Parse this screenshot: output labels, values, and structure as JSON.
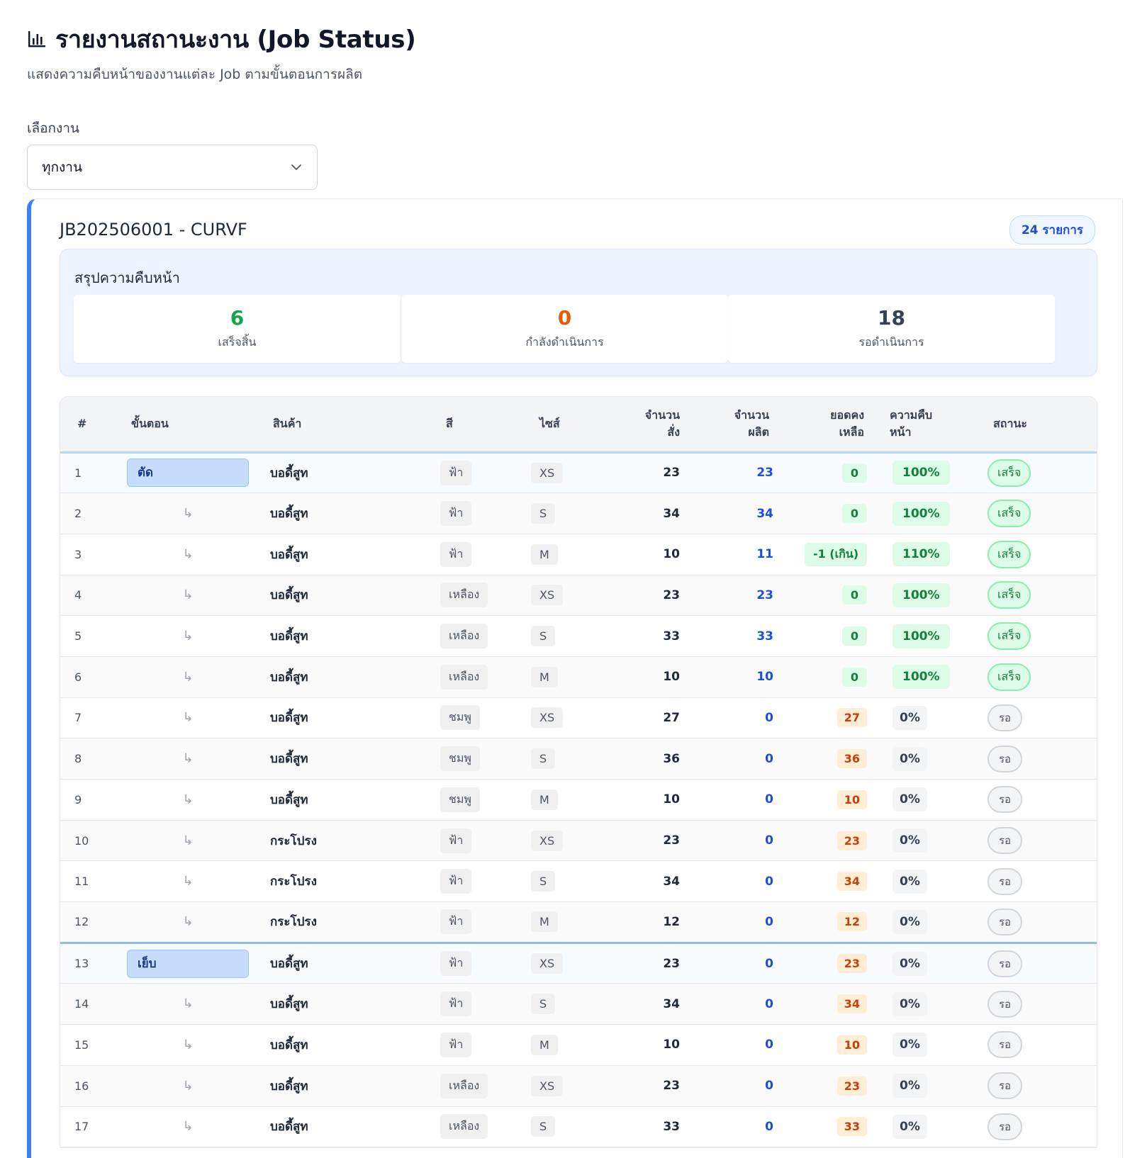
{
  "header": {
    "title": "รายงานสถานะงาน (Job Status)",
    "subtitle": "แสดงความคืบหน้าของงานแต่ละ Job ตามขั้นตอนการผลิต",
    "icon": "bar-chart-icon"
  },
  "filter": {
    "label": "เลือกงาน",
    "selected": "ทุกงาน"
  },
  "job": {
    "title": "JB202506001 - CURVF",
    "count_badge": "24 รายการ",
    "summary": {
      "title": "สรุปความคืบหน้า",
      "done": {
        "value": "6",
        "label": "เสร็จสิ้น",
        "color": "#16a34a"
      },
      "in_progress": {
        "value": "0",
        "label": "กำลังดำเนินการ",
        "color": "#ea580c"
      },
      "waiting": {
        "value": "18",
        "label": "รอดำเนินการ",
        "color": "#374151"
      }
    }
  },
  "table": {
    "headers": {
      "num": "#",
      "step": "ขั้นตอน",
      "product": "สินค้า",
      "color": "สี",
      "size": "ไซส์",
      "order_qty_1": "จำนวน",
      "order_qty_2": "สั่ง",
      "produced_1": "จำนวน",
      "produced_2": "ผลิต",
      "remain_1": "ยอดคง",
      "remain_2": "เหลือ",
      "progress_1": "ความคืบ",
      "progress_2": "หน้า",
      "status": "สถานะ"
    },
    "continuation_mark": "↳",
    "rows": [
      {
        "num": "1",
        "step": "ตัด",
        "product": "บอดี้สูท",
        "color": "ฟ้า",
        "size": "XS",
        "order": "23",
        "produced": "23",
        "remain": "0",
        "remain_kind": "ok",
        "pct": "100%",
        "status": "เสร็จ"
      },
      {
        "num": "2",
        "step": "",
        "product": "บอดี้สูท",
        "color": "ฟ้า",
        "size": "S",
        "order": "34",
        "produced": "34",
        "remain": "0",
        "remain_kind": "ok",
        "pct": "100%",
        "status": "เสร็จ"
      },
      {
        "num": "3",
        "step": "",
        "product": "บอดี้สูท",
        "color": "ฟ้า",
        "size": "M",
        "order": "10",
        "produced": "11",
        "remain": "-1 (เกิน)",
        "remain_kind": "over",
        "pct": "110%",
        "status": "เสร็จ"
      },
      {
        "num": "4",
        "step": "",
        "product": "บอดี้สูท",
        "color": "เหลือง",
        "size": "XS",
        "order": "23",
        "produced": "23",
        "remain": "0",
        "remain_kind": "ok",
        "pct": "100%",
        "status": "เสร็จ"
      },
      {
        "num": "5",
        "step": "",
        "product": "บอดี้สูท",
        "color": "เหลือง",
        "size": "S",
        "order": "33",
        "produced": "33",
        "remain": "0",
        "remain_kind": "ok",
        "pct": "100%",
        "status": "เสร็จ"
      },
      {
        "num": "6",
        "step": "",
        "product": "บอดี้สูท",
        "color": "เหลือง",
        "size": "M",
        "order": "10",
        "produced": "10",
        "remain": "0",
        "remain_kind": "ok",
        "pct": "100%",
        "status": "เสร็จ"
      },
      {
        "num": "7",
        "step": "",
        "product": "บอดี้สูท",
        "color": "ชมพู",
        "size": "XS",
        "order": "27",
        "produced": "0",
        "remain": "27",
        "remain_kind": "left",
        "pct": "0%",
        "status": "รอ"
      },
      {
        "num": "8",
        "step": "",
        "product": "บอดี้สูท",
        "color": "ชมพู",
        "size": "S",
        "order": "36",
        "produced": "0",
        "remain": "36",
        "remain_kind": "left",
        "pct": "0%",
        "status": "รอ"
      },
      {
        "num": "9",
        "step": "",
        "product": "บอดี้สูท",
        "color": "ชมพู",
        "size": "M",
        "order": "10",
        "produced": "0",
        "remain": "10",
        "remain_kind": "left",
        "pct": "0%",
        "status": "รอ"
      },
      {
        "num": "10",
        "step": "",
        "product": "กระโปรง",
        "color": "ฟ้า",
        "size": "XS",
        "order": "23",
        "produced": "0",
        "remain": "23",
        "remain_kind": "left",
        "pct": "0%",
        "status": "รอ"
      },
      {
        "num": "11",
        "step": "",
        "product": "กระโปรง",
        "color": "ฟ้า",
        "size": "S",
        "order": "34",
        "produced": "0",
        "remain": "34",
        "remain_kind": "left",
        "pct": "0%",
        "status": "รอ"
      },
      {
        "num": "12",
        "step": "",
        "product": "กระโปรง",
        "color": "ฟ้า",
        "size": "M",
        "order": "12",
        "produced": "0",
        "remain": "12",
        "remain_kind": "left",
        "pct": "0%",
        "status": "รอ"
      },
      {
        "num": "13",
        "step": "เย็บ",
        "product": "บอดี้สูท",
        "color": "ฟ้า",
        "size": "XS",
        "order": "23",
        "produced": "0",
        "remain": "23",
        "remain_kind": "left",
        "pct": "0%",
        "status": "รอ"
      },
      {
        "num": "14",
        "step": "",
        "product": "บอดี้สูท",
        "color": "ฟ้า",
        "size": "S",
        "order": "34",
        "produced": "0",
        "remain": "34",
        "remain_kind": "left",
        "pct": "0%",
        "status": "รอ"
      },
      {
        "num": "15",
        "step": "",
        "product": "บอดี้สูท",
        "color": "ฟ้า",
        "size": "M",
        "order": "10",
        "produced": "0",
        "remain": "10",
        "remain_kind": "left",
        "pct": "0%",
        "status": "รอ"
      },
      {
        "num": "16",
        "step": "",
        "product": "บอดี้สูท",
        "color": "เหลือง",
        "size": "XS",
        "order": "23",
        "produced": "0",
        "remain": "23",
        "remain_kind": "left",
        "pct": "0%",
        "status": "รอ"
      },
      {
        "num": "17",
        "step": "",
        "product": "บอดี้สูท",
        "color": "เหลือง",
        "size": "S",
        "order": "33",
        "produced": "0",
        "remain": "33",
        "remain_kind": "left",
        "pct": "0%",
        "status": "รอ"
      }
    ]
  }
}
